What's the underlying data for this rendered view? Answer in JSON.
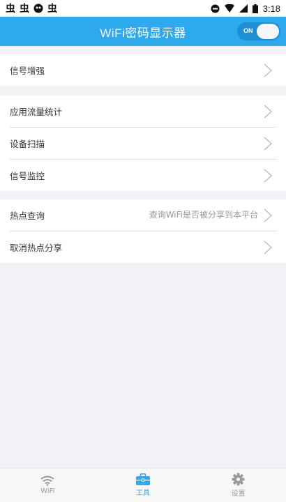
{
  "status_bar": {
    "left_icons": [
      "虫",
      "虫",
      "bug-face-icon",
      "虫"
    ],
    "right_icons": [
      "do-not-disturb-icon",
      "wifi-icon",
      "signal-icon",
      "battery-icon"
    ],
    "time": "3:18"
  },
  "app_bar": {
    "title": "WiFi密码显示器",
    "toggle_label": "ON",
    "toggle_state": "on",
    "color": "#2fa9ee"
  },
  "groups": [
    {
      "items": [
        {
          "label": "信号增强"
        }
      ]
    },
    {
      "items": [
        {
          "label": "应用流量统计"
        },
        {
          "label": "设备扫描"
        },
        {
          "label": "信号监控"
        }
      ]
    },
    {
      "items": [
        {
          "label": "热点查询",
          "hint": "查询WiFi是否被分享到本平台"
        },
        {
          "label": "取消热点分享"
        }
      ]
    }
  ],
  "bottom_nav": {
    "items": [
      {
        "label": "WiFi",
        "icon": "wifi-icon",
        "active": false
      },
      {
        "label": "工具",
        "icon": "toolbox-icon",
        "active": true
      },
      {
        "label": "设置",
        "icon": "gear-icon",
        "active": false
      }
    ],
    "active_color": "#2fa9ee",
    "inactive_color": "#9a9a9a"
  }
}
